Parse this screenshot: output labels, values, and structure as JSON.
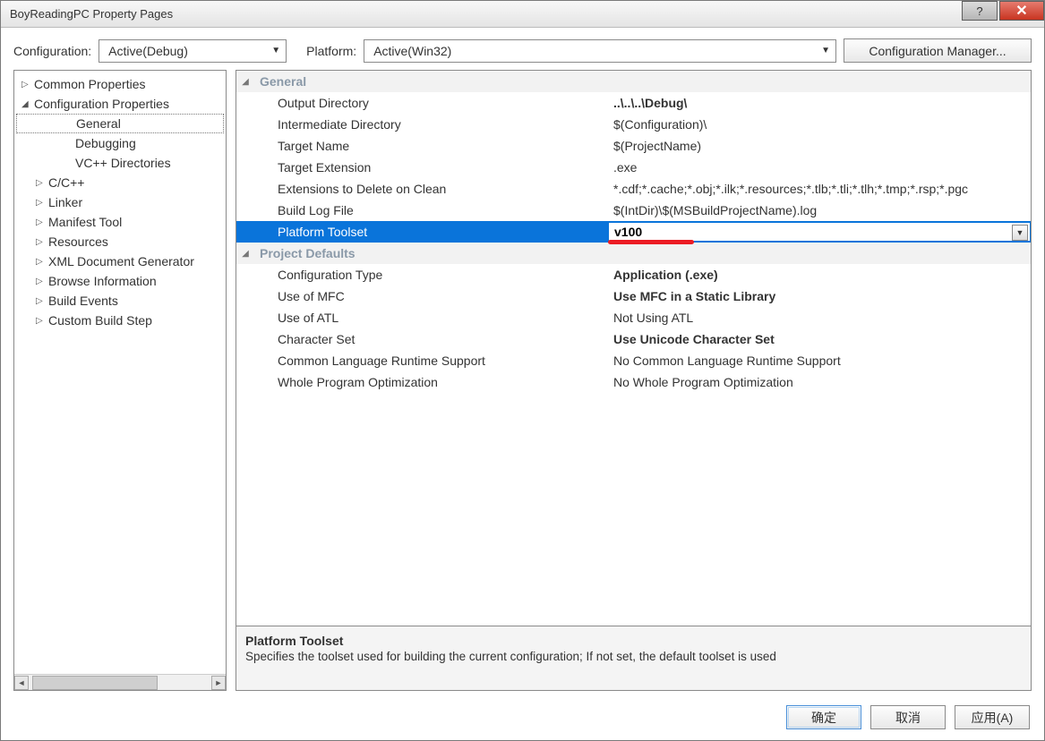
{
  "window_title": "BoyReadingPC Property Pages",
  "toolbar": {
    "config_label": "Configuration:",
    "config_value": "Active(Debug)",
    "platform_label": "Platform:",
    "platform_value": "Active(Win32)",
    "config_manager": "Configuration Manager..."
  },
  "tree": {
    "items": [
      {
        "label": "Common Properties",
        "expand": "▷",
        "indent": 0
      },
      {
        "label": "Configuration Properties",
        "expand": "◢",
        "indent": 0
      },
      {
        "label": "General",
        "indent": 2,
        "selected": true
      },
      {
        "label": "Debugging",
        "indent": 2
      },
      {
        "label": "VC++ Directories",
        "indent": 2
      },
      {
        "label": "C/C++",
        "expand": "▷",
        "indent": 1
      },
      {
        "label": "Linker",
        "expand": "▷",
        "indent": 1
      },
      {
        "label": "Manifest Tool",
        "expand": "▷",
        "indent": 1
      },
      {
        "label": "Resources",
        "expand": "▷",
        "indent": 1
      },
      {
        "label": "XML Document Generator",
        "expand": "▷",
        "indent": 1
      },
      {
        "label": "Browse Information",
        "expand": "▷",
        "indent": 1
      },
      {
        "label": "Build Events",
        "expand": "▷",
        "indent": 1
      },
      {
        "label": "Custom Build Step",
        "expand": "▷",
        "indent": 1
      }
    ]
  },
  "groups": [
    {
      "name": "General",
      "rows": [
        {
          "label": "Output Directory",
          "value": "..\\..\\..\\Debug\\",
          "bold": true
        },
        {
          "label": "Intermediate Directory",
          "value": "$(Configuration)\\"
        },
        {
          "label": "Target Name",
          "value": "$(ProjectName)"
        },
        {
          "label": "Target Extension",
          "value": ".exe"
        },
        {
          "label": "Extensions to Delete on Clean",
          "value": "*.cdf;*.cache;*.obj;*.ilk;*.resources;*.tlb;*.tli;*.tlh;*.tmp;*.rsp;*.pgc"
        },
        {
          "label": "Build Log File",
          "value": "$(IntDir)\\$(MSBuildProjectName).log"
        },
        {
          "label": "Platform Toolset",
          "value": "v100",
          "bold": true,
          "selected": true,
          "dropdown": true
        }
      ]
    },
    {
      "name": "Project Defaults",
      "rows": [
        {
          "label": "Configuration Type",
          "value": "Application (.exe)",
          "bold": true
        },
        {
          "label": "Use of MFC",
          "value": "Use MFC in a Static Library",
          "bold": true
        },
        {
          "label": "Use of ATL",
          "value": "Not Using ATL"
        },
        {
          "label": "Character Set",
          "value": "Use Unicode Character Set",
          "bold": true
        },
        {
          "label": "Common Language Runtime Support",
          "value": "No Common Language Runtime Support"
        },
        {
          "label": "Whole Program Optimization",
          "value": "No Whole Program Optimization"
        }
      ]
    }
  ],
  "description": {
    "title": "Platform Toolset",
    "text": "Specifies the toolset used for building the current configuration; If not set, the default toolset is used"
  },
  "footer": {
    "ok": "确定",
    "cancel": "取消",
    "apply": "应用(A)"
  },
  "glyphs": {
    "help": "?",
    "close": "✕",
    "down": "▼",
    "left": "◄",
    "right": "►",
    "collapse": "◢"
  }
}
